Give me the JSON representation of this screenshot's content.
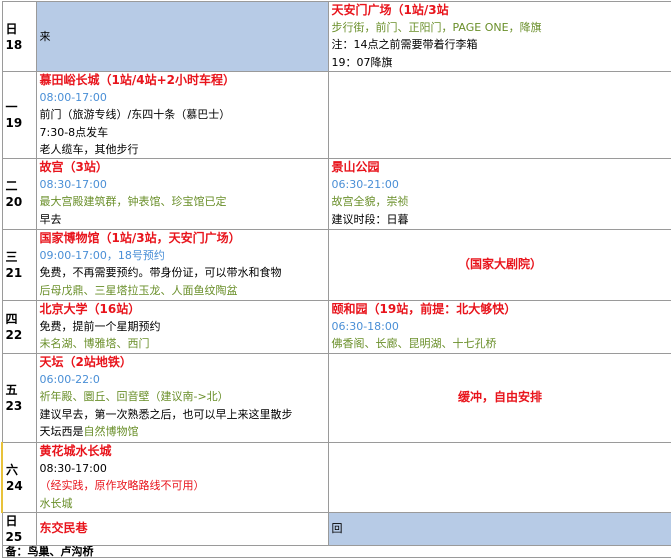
{
  "days": [
    {
      "weekday": "日",
      "date": "18"
    },
    {
      "weekday": "一",
      "date": "19"
    },
    {
      "weekday": "二",
      "date": "20"
    },
    {
      "weekday": "三",
      "date": "21"
    },
    {
      "weekday": "四",
      "date": "22"
    },
    {
      "weekday": "五",
      "date": "23"
    },
    {
      "weekday": "六",
      "date": "24"
    },
    {
      "weekday": "日",
      "date": "25"
    }
  ],
  "r18": {
    "am": "来",
    "pm_title": "天安门广场（1站/3站",
    "pm_sub": "步行街，前门、正阳门，PAGE ONE，降旗",
    "pm_note1": "注：14点之前需要带着行李箱",
    "pm_note2": "19：07降旗"
  },
  "r19": {
    "am_title": "慕田峪长城（1站/4站+2小时车程）",
    "am_time": "08:00-17:00",
    "am_l1": "前门（旅游专线）/东四十条（慕巴士）",
    "am_l2": "7:30-8点发车",
    "am_l3": "老人缆车，其他步行"
  },
  "r20": {
    "am_title": "故宫（3站）",
    "am_time": "08:30-17:00",
    "am_sub": "最大宫殿建筑群，钟表馆、珍宝馆已定",
    "am_note": "早去",
    "pm_title": "景山公园",
    "pm_time": "06:30-21:00",
    "pm_sub": "故宫全貌，崇祯",
    "pm_note": "建议时段：日暮"
  },
  "r21": {
    "am_title": "国家博物馆（1站/3站，天安门广场）",
    "am_time": "09:00-17:00，18号预约",
    "am_l1": "免费，不再需要预约。带身份证，可以带水和食物",
    "am_sub": "后母戊鼎、三星塔拉玉龙、人面鱼纹陶盆",
    "pm_title": "（国家大剧院）"
  },
  "r22": {
    "am_title": "北京大学（16站）",
    "am_l1": "免费，提前一个星期预约",
    "am_sub": "未名湖、博雅塔、西门",
    "pm_title": "颐和园（19站，前提：北大够快）",
    "pm_time": "06:30-18:00",
    "pm_sub": "佛香阁、长廊、昆明湖、十七孔桥"
  },
  "r23": {
    "am_title": "天坛（2站地铁）",
    "am_time": "06:00-22:0",
    "am_sub": "祈年殿、圜丘、回音壁（建议南->北）",
    "am_l1": "建议早去，第一次熟悉之后，也可以早上来这里散步",
    "am_l2a": "天坛西是",
    "am_l2b": "自然博物馆",
    "pm_title": "缓冲，自由安排"
  },
  "r24": {
    "am_title": "黄花城水长城",
    "am_time": "08:30-17:00",
    "am_note": "（经实践，原作攻略路线不可用）",
    "am_sub": "水长城"
  },
  "r25": {
    "am_title": "东交民巷",
    "pm": "回"
  },
  "footer": "备：鸟巢、卢沟桥"
}
